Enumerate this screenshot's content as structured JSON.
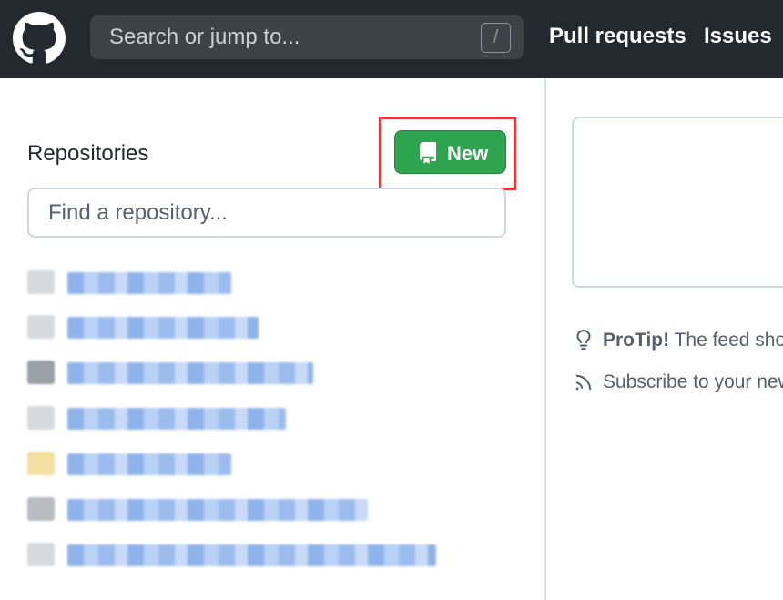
{
  "header": {
    "logo_icon": "github-octocat-icon",
    "search_placeholder": "Search or jump to...",
    "search_shortcut": "/",
    "nav": [
      {
        "label": "Pull requests"
      },
      {
        "label": "Issues"
      }
    ]
  },
  "repositories": {
    "title": "Repositories",
    "new_button_label": "New",
    "new_button_icon": "repo-icon",
    "find_placeholder": "Find a repository...",
    "items": [
      {
        "name": ""
      },
      {
        "name": ""
      },
      {
        "name": ""
      },
      {
        "name": ""
      },
      {
        "name": ""
      },
      {
        "name": ""
      },
      {
        "name": ""
      }
    ]
  },
  "right": {
    "protip_bold": "ProTip!",
    "protip_text": " The feed shows",
    "subscribe_text": "Subscribe to your news",
    "protip_icon": "light-bulb-icon",
    "subscribe_icon": "rss-icon"
  },
  "colors": {
    "header_bg": "#24292f",
    "new_button_bg": "#2da44e",
    "highlight_border": "#e0393e",
    "link_blue": "#0969da"
  }
}
